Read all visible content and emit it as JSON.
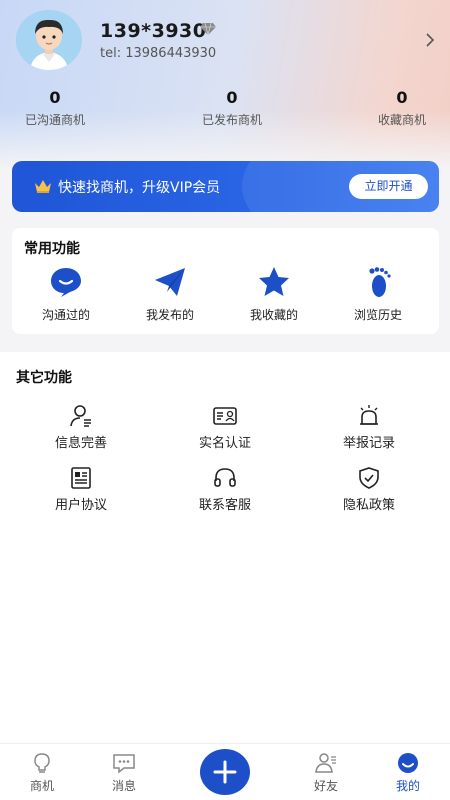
{
  "profile": {
    "username": "139*3930",
    "tel": "tel: 13986443930",
    "avatar_icon": "avatar-icon",
    "vip_icon": "diamond-icon",
    "chevron_icon": "chevron-right-icon"
  },
  "stats": [
    {
      "value": "0",
      "label": "已沟通商机"
    },
    {
      "value": "0",
      "label": "已发布商机"
    },
    {
      "value": "0",
      "label": "收藏商机"
    }
  ],
  "vip_banner": {
    "text": "快速找商机，升级VIP会员",
    "button": "立即开通",
    "icon": "crown-icon"
  },
  "common": {
    "title": "常用功能",
    "items": [
      {
        "label": "沟通过的",
        "icon": "chat-bubble-icon"
      },
      {
        "label": "我发布的",
        "icon": "paper-plane-icon"
      },
      {
        "label": "我收藏的",
        "icon": "star-icon"
      },
      {
        "label": "浏览历史",
        "icon": "footprint-icon"
      }
    ]
  },
  "other": {
    "title": "其它功能",
    "items": [
      {
        "label": "信息完善",
        "icon": "user-edit-icon"
      },
      {
        "label": "实名认证",
        "icon": "id-card-icon"
      },
      {
        "label": "举报记录",
        "icon": "alarm-icon"
      },
      {
        "label": "用户协议",
        "icon": "document-icon"
      },
      {
        "label": "联系客服",
        "icon": "headset-icon"
      },
      {
        "label": "隐私政策",
        "icon": "shield-check-icon"
      }
    ]
  },
  "tabbar": {
    "items": [
      {
        "label": "商机",
        "icon": "lightbulb-icon"
      },
      {
        "label": "消息",
        "icon": "message-icon"
      },
      {
        "label": "好友",
        "icon": "friends-icon"
      },
      {
        "label": "我的",
        "icon": "profile-icon"
      }
    ],
    "center_icon": "plus-icon",
    "active": "我的"
  },
  "colors": {
    "accent": "#1d4fc8",
    "banner": "#2a66e6"
  }
}
